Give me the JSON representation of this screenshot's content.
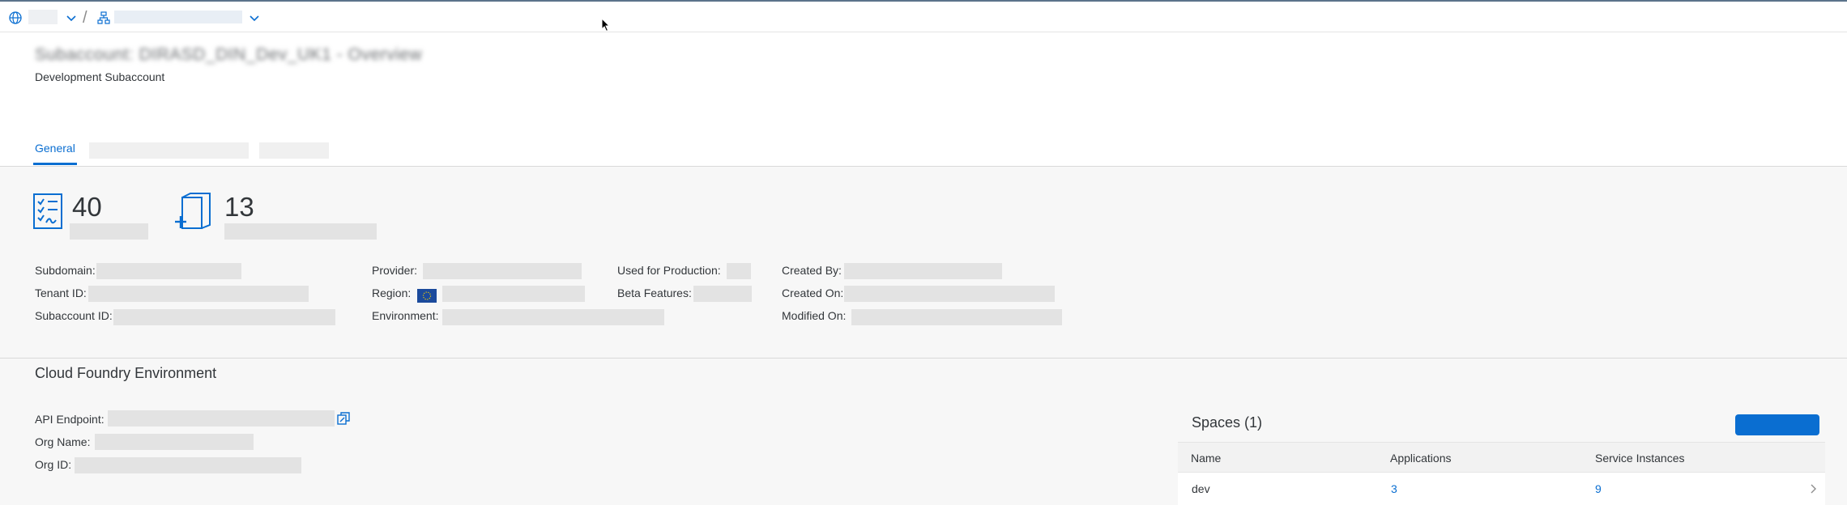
{
  "header": {
    "title": "Subaccount: DIRASD_DIN_Dev_UK1 - Overview",
    "subtitle": "Development Subaccount"
  },
  "tabs": [
    {
      "label": "General"
    }
  ],
  "kpis": [
    {
      "value": "40",
      "icon": "checklist-icon"
    },
    {
      "value": "13",
      "icon": "add-document-icon"
    }
  ],
  "details": {
    "subdomain_label": "Subdomain:",
    "tenant_label": "Tenant ID:",
    "subaccount_label": "Subaccount ID:",
    "provider_label": "Provider:",
    "region_label": "Region:",
    "environment_label": "Environment:",
    "production_label": "Used for Production:",
    "beta_label": "Beta Features:",
    "created_by_label": "Created By:",
    "created_on_label": "Created On:",
    "modified_on_label": "Modified On:"
  },
  "cf": {
    "title": "Cloud Foundry Environment",
    "api_label": "API Endpoint:",
    "org_name_label": "Org Name:",
    "org_id_label": "Org ID:"
  },
  "spaces": {
    "title": "Spaces (1)",
    "columns": [
      "Name",
      "Applications",
      "Service Instances"
    ],
    "rows": [
      {
        "name": "dev",
        "applications": "3",
        "service_instances": "9"
      }
    ]
  },
  "colors": {
    "accent": "#0a6ed1",
    "text": "#32363a",
    "background": "#f7f7f7"
  }
}
